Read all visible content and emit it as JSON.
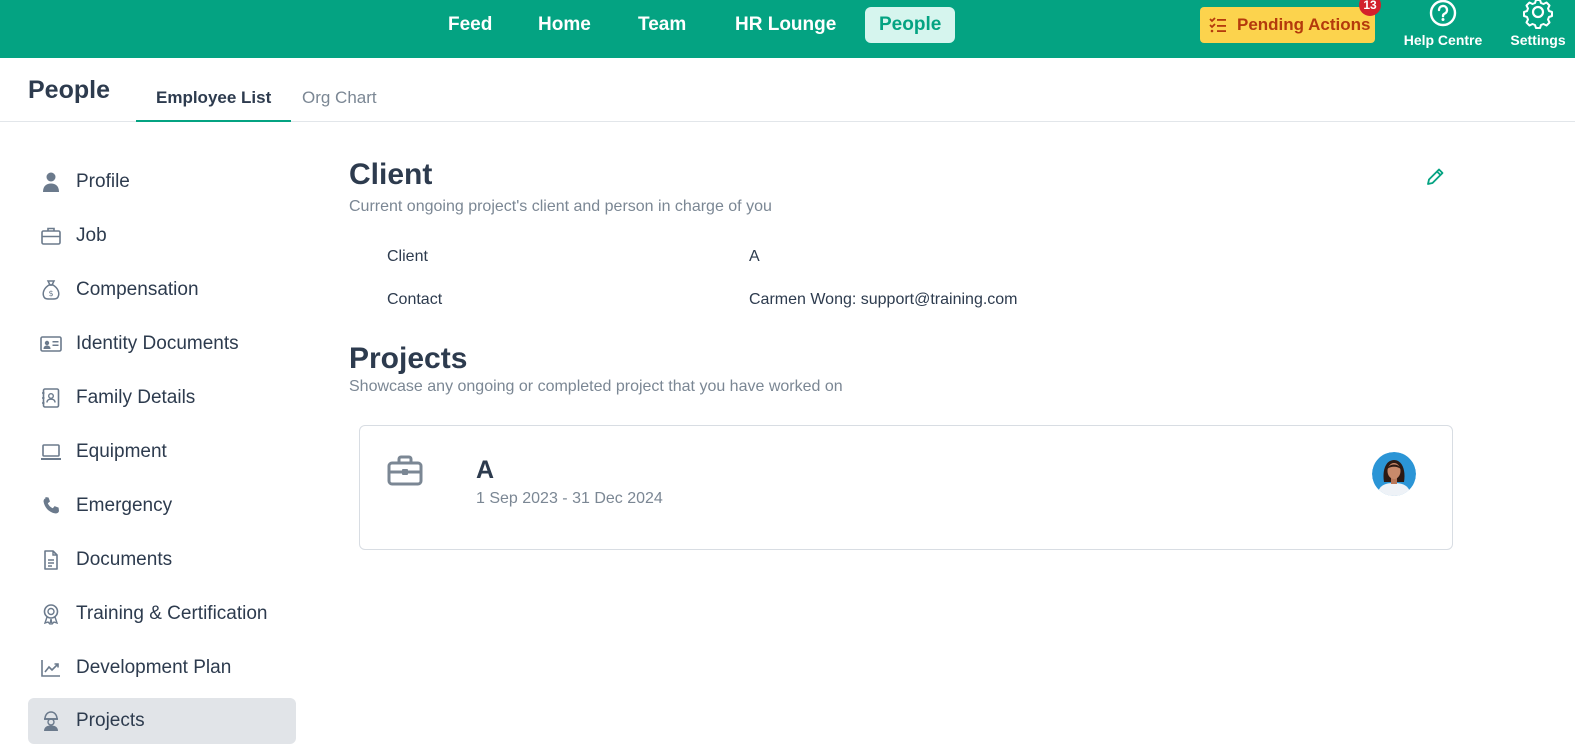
{
  "topnav": {
    "items": [
      {
        "label": "Feed"
      },
      {
        "label": "Home"
      },
      {
        "label": "Team"
      },
      {
        "label": "HR Lounge"
      },
      {
        "label": "People",
        "active": true
      }
    ],
    "pending_actions": {
      "label": "Pending Actions",
      "count": "13"
    },
    "help_label": "Help Centre",
    "settings_label": "Settings"
  },
  "header": {
    "title": "People",
    "tabs": [
      {
        "label": "Employee List",
        "active": true
      },
      {
        "label": "Org Chart"
      }
    ]
  },
  "sidebar": {
    "items": [
      {
        "label": "Profile",
        "icon": "person-icon"
      },
      {
        "label": "Job",
        "icon": "briefcase-icon"
      },
      {
        "label": "Compensation",
        "icon": "money-bag-icon"
      },
      {
        "label": "Identity Documents",
        "icon": "id-card-icon"
      },
      {
        "label": "Family Details",
        "icon": "contact-book-icon"
      },
      {
        "label": "Equipment",
        "icon": "laptop-icon"
      },
      {
        "label": "Emergency",
        "icon": "phone-icon"
      },
      {
        "label": "Documents",
        "icon": "document-icon"
      },
      {
        "label": "Training & Certification",
        "icon": "award-icon"
      },
      {
        "label": "Development Plan",
        "icon": "trend-chart-icon"
      },
      {
        "label": "Projects",
        "icon": "worker-icon",
        "active": true
      }
    ]
  },
  "client": {
    "title": "Client",
    "subtitle": "Current ongoing project's client and person in charge of you",
    "rows": [
      {
        "key": "Client",
        "value": "A"
      },
      {
        "key": "Contact",
        "value": "Carmen Wong: support@training.com"
      }
    ]
  },
  "projects": {
    "title": "Projects",
    "subtitle": "Showcase any ongoing or completed project that you have worked on",
    "items": [
      {
        "name": "A",
        "dates": "1 Sep 2023 - 31 Dec 2024"
      }
    ]
  },
  "colors": {
    "brand": "#04a382",
    "pending_bg": "#fcd34d",
    "pending_text": "#b43a0c",
    "badge": "#d3202b"
  }
}
